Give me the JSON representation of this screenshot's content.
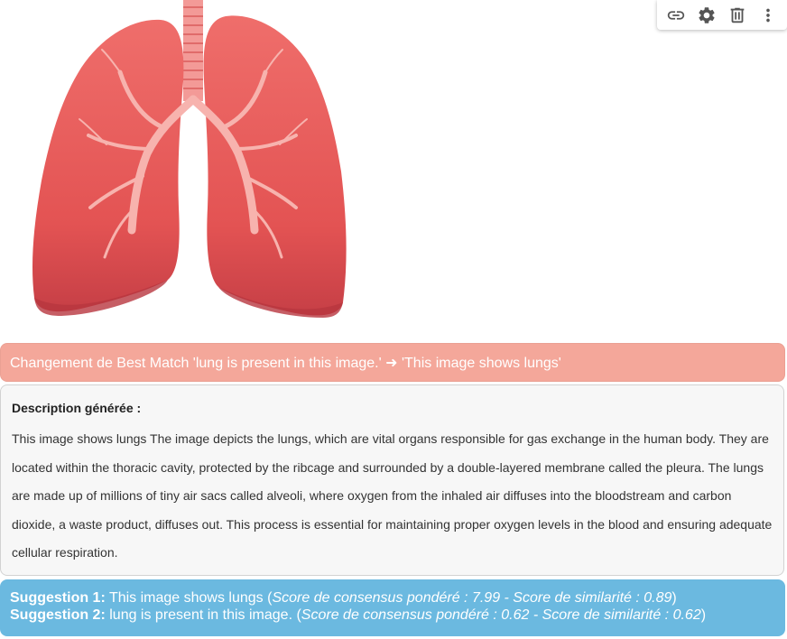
{
  "toolbar": {
    "icons": [
      "link-icon",
      "gear-icon",
      "trash-icon",
      "more-vert-icon"
    ]
  },
  "image": {
    "subject": "lungs-illustration"
  },
  "change_banner": {
    "text": "Changement de Best Match 'lung is present in this image.' ➜ 'This image shows lungs'"
  },
  "description": {
    "title": "Description générée :",
    "text": "This image shows lungs The image depicts the lungs, which are vital organs responsible for gas exchange in the human body. They are located within the thoracic cavity, protected by the ribcage and surrounded by a double-layered membrane called the pleura. The lungs are made up of millions of tiny air sacs called alveoli, where oxygen from the inhaled air diffuses into the bloodstream and carbon dioxide, a waste product, diffuses out. This process is essential for maintaining proper oxygen levels in the blood and ensuring adequate cellular respiration."
  },
  "suggestions": [
    {
      "label": "Suggestion 1:",
      "text": "This image shows lungs",
      "open": " (",
      "scores": "Score de consensus pondéré : 7.99 - Score de similarité : 0.89",
      "close": ")"
    },
    {
      "label": "Suggestion 2:",
      "text": "lung is present in this image.",
      "open": " (",
      "scores": "Score de consensus pondéré : 0.62 - Score de similarité : 0.62",
      "close": ")"
    }
  ],
  "colors": {
    "banner_bg": "#f4a79a",
    "suggestions_bg": "#6bb9e0",
    "lung_main": "#e8585a",
    "lung_dark": "#c43d44",
    "trachea": "#f08f8d"
  }
}
